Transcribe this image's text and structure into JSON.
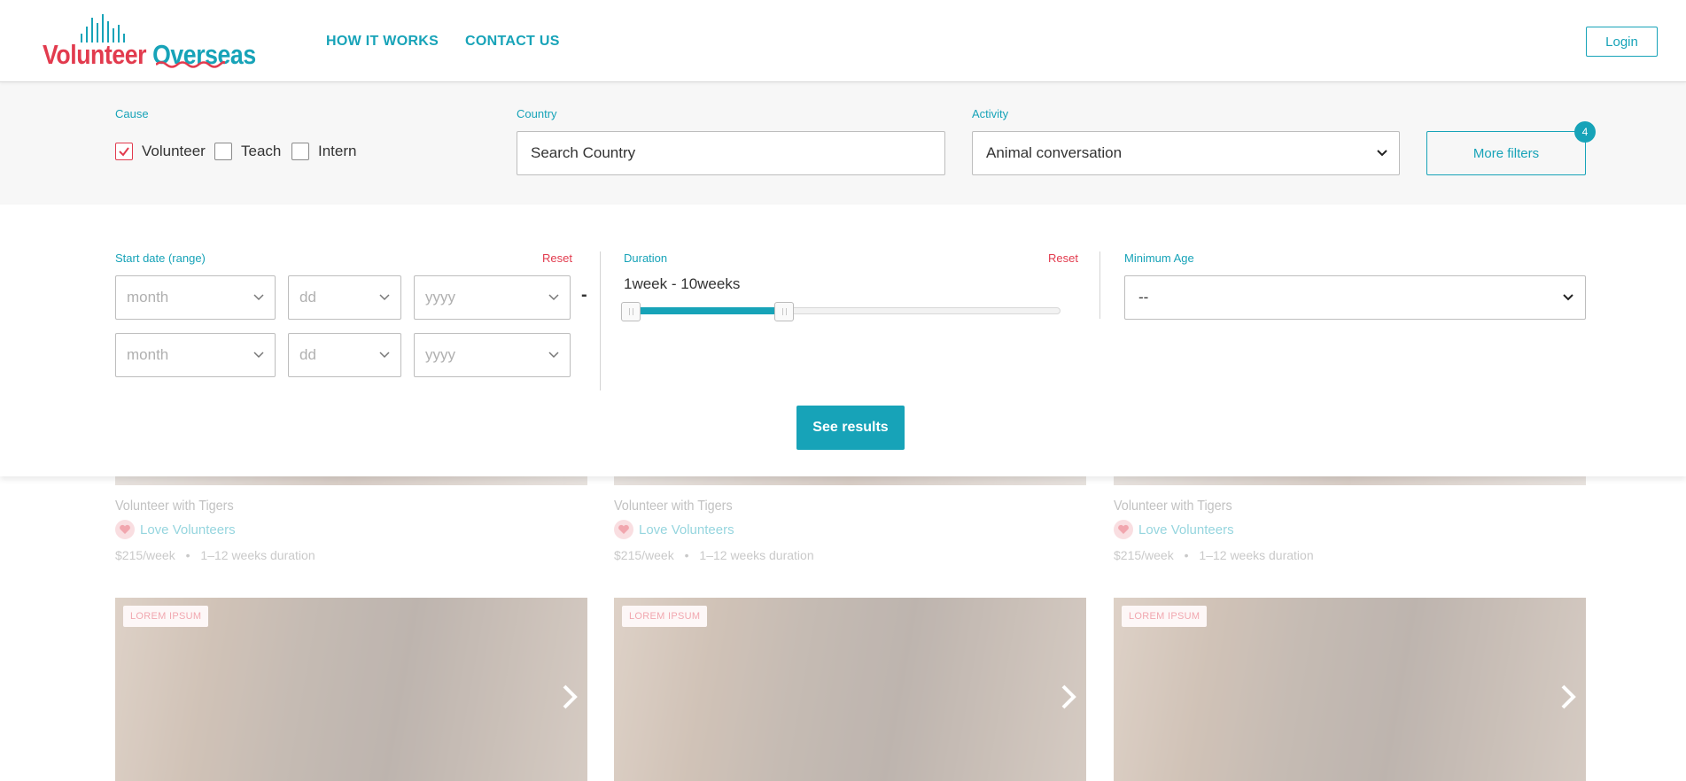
{
  "header": {
    "logo": {
      "part1": "Volunteer",
      "part2": "Overseas"
    },
    "nav": [
      "HOW IT WORKS",
      "CONTACT US"
    ],
    "login_label": "Login"
  },
  "filters": {
    "cause": {
      "label": "Cause",
      "options": [
        {
          "label": "Volunteer",
          "checked": true
        },
        {
          "label": "Teach",
          "checked": false
        },
        {
          "label": "Intern",
          "checked": false
        }
      ]
    },
    "country": {
      "label": "Country",
      "placeholder": "Search Country"
    },
    "activity": {
      "label": "Activity",
      "value": "Animal conversation"
    },
    "more_filters": {
      "label": "More filters",
      "badge": "4"
    }
  },
  "panel": {
    "start_date": {
      "label": "Start date (range)",
      "reset": "Reset",
      "rows": [
        {
          "month": "month",
          "day": "dd",
          "year": "yyyy"
        },
        {
          "month": "month",
          "day": "dd",
          "year": "yyyy"
        }
      ],
      "separator": "-"
    },
    "duration": {
      "label": "Duration",
      "reset": "Reset",
      "value_text": "1week - 10weeks",
      "min_weeks": 1,
      "max_weeks": 10
    },
    "min_age": {
      "label": "Minimum Age",
      "value": "--"
    },
    "see_results": "See results"
  },
  "results": {
    "cards": [
      {
        "title": "Volunteer with Tigers",
        "org": "Love Volunteers",
        "price": "$215/week",
        "duration": "1–12 weeks duration"
      },
      {
        "title": "Volunteer with Tigers",
        "org": "Love Volunteers",
        "price": "$215/week",
        "duration": "1–12 weeks duration"
      },
      {
        "title": "Volunteer with Tigers",
        "org": "Love Volunteers",
        "price": "$215/week",
        "duration": "1–12 weeks duration"
      }
    ],
    "photo_cards": [
      {
        "tag": "LOREM IPSUM"
      },
      {
        "tag": "LOREM IPSUM"
      },
      {
        "tag": "LOREM IPSUM"
      }
    ],
    "bullet": "•"
  },
  "colors": {
    "teal": "#17a3b8",
    "red": "#e23b4e"
  }
}
